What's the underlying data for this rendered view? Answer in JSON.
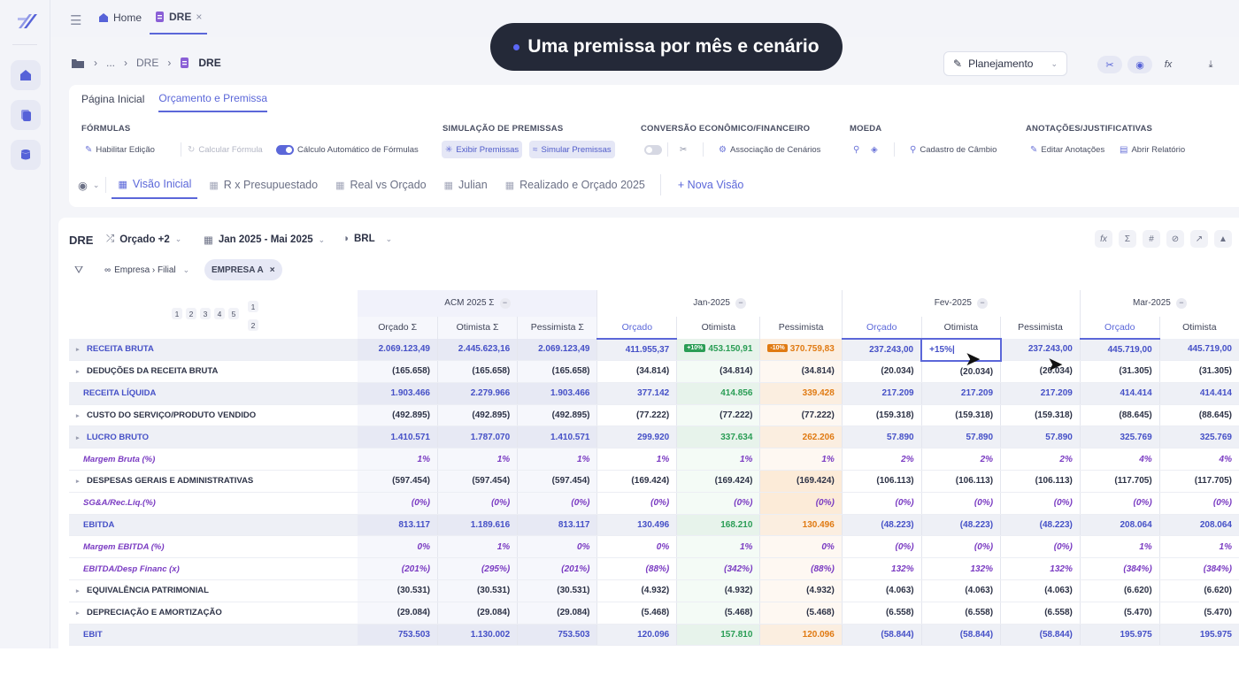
{
  "topbar": {
    "tabs": [
      {
        "label": "Home",
        "icon": "home-icon",
        "active": false
      },
      {
        "label": "DRE",
        "icon": "document-icon",
        "active": true,
        "close": "×"
      }
    ]
  },
  "toast": {
    "text": "Uma premissa por mês e cenário"
  },
  "breadcrumb": {
    "ellipsis": "...",
    "parent": "DRE",
    "current": "DRE"
  },
  "mode_select": {
    "label": "Planejamento"
  },
  "ribbon": {
    "tabs": [
      {
        "label": "Página Inicial",
        "active": false
      },
      {
        "label": "Orçamento e Premissa",
        "active": true
      }
    ],
    "groups": {
      "formulas": "FÓRMULAS",
      "simulacao": "SIMULAÇÃO DE PREMISSAS",
      "conversao": "CONVERSÃO ECONÔMICO/FINANCEIRO",
      "moeda": "MOEDA",
      "anotacoes": "ANOTAÇÕES/JUSTIFICATIVAS"
    },
    "buttons": {
      "habilitar": "Habilitar Edição",
      "calcular": "Calcular Fórmula",
      "calculo_auto": "Cálculo Automático de Fórmulas",
      "exibir": "Exibir Premissas",
      "simular": "Simular Premissas",
      "associacao": "Associação de Cenários",
      "cambio": "Cadastro de Câmbio",
      "editar_anot": "Editar Anotações",
      "abrir_rel": "Abrir Relatório"
    },
    "views": [
      {
        "label": "Visão Inicial",
        "active": true
      },
      {
        "label": "R x Presupuestado",
        "active": false
      },
      {
        "label": "Real vs Orçado",
        "active": false
      },
      {
        "label": "Julian",
        "active": false
      },
      {
        "label": "Realizado e Orçado 2025",
        "active": false
      }
    ],
    "new_view": "+ Nova Visão"
  },
  "report": {
    "title": "DRE",
    "scenario": "Orçado +2",
    "period": "Jan 2025 - Mai 2025",
    "currency": "BRL",
    "filter_chip": "Empresa › Filial",
    "selected_chip": "EMPRESA A",
    "selected_chip_close": "×",
    "levels": [
      "1",
      "2",
      "3",
      "4",
      "5"
    ],
    "side_levels": [
      "1",
      "2"
    ]
  },
  "columns": {
    "groups": [
      {
        "label": "ACM 2025 Σ",
        "toggle": "−"
      },
      {
        "label": "Jan-2025",
        "toggle": "−"
      },
      {
        "label": "Fev-2025",
        "toggle": "−"
      },
      {
        "label": "Mar-2025",
        "toggle": "−"
      }
    ],
    "sub": [
      "Orçado Σ",
      "Otimista Σ",
      "Pessimista Σ",
      "Orçado",
      "Otimista",
      "Pessimista",
      "Orçado",
      "Otimista",
      "Pessimista",
      "Orçado",
      "Otimista"
    ]
  },
  "rows": [
    {
      "label": "RECEITA BRUTA",
      "tri": "▸",
      "type": "hl",
      "values": [
        "2.069.123,49",
        "2.445.623,16",
        "2.069.123,49",
        "411.955,37",
        "453.150,91",
        "370.759,83",
        "237.243,00",
        "+15%|",
        "237.243,00",
        "445.719,00",
        "445.719,00"
      ],
      "badges": {
        "4": "+10%",
        "5": "-10%"
      }
    },
    {
      "label": "DEDUÇÕES DA RECEITA BRUTA",
      "tri": "▸",
      "type": "normal",
      "values": [
        "(165.658)",
        "(165.658)",
        "(165.658)",
        "(34.814)",
        "(34.814)",
        "(34.814)",
        "(20.034)",
        "(20.034)",
        "(20.034)",
        "(31.305)",
        "(31.305)"
      ]
    },
    {
      "label": "RECEITA LÍQUIDA",
      "tri": "",
      "type": "hl",
      "values": [
        "1.903.466",
        "2.279.966",
        "1.903.466",
        "377.142",
        "414.856",
        "339.428",
        "217.209",
        "217.209",
        "217.209",
        "414.414",
        "414.414"
      ]
    },
    {
      "label": "CUSTO DO SERVIÇO/PRODUTO VENDIDO",
      "tri": "▸",
      "type": "normal",
      "values": [
        "(492.895)",
        "(492.895)",
        "(492.895)",
        "(77.222)",
        "(77.222)",
        "(77.222)",
        "(159.318)",
        "(159.318)",
        "(159.318)",
        "(88.645)",
        "(88.645)"
      ]
    },
    {
      "label": "LUCRO BRUTO",
      "tri": "▸",
      "type": "hl",
      "values": [
        "1.410.571",
        "1.787.070",
        "1.410.571",
        "299.920",
        "337.634",
        "262.206",
        "57.890",
        "57.890",
        "57.890",
        "325.769",
        "325.769"
      ]
    },
    {
      "label": "Margem Bruta (%)",
      "tri": "",
      "type": "ital",
      "values": [
        "1%",
        "1%",
        "1%",
        "1%",
        "1%",
        "1%",
        "2%",
        "2%",
        "2%",
        "4%",
        "4%"
      ]
    },
    {
      "label": "DESPESAS GERAIS E ADMINISTRATIVAS",
      "tri": "▸",
      "type": "normal",
      "values": [
        "(597.454)",
        "(597.454)",
        "(597.454)",
        "(169.424)",
        "(169.424)",
        "(169.424)",
        "(106.113)",
        "(106.113)",
        "(106.113)",
        "(117.705)",
        "(117.705)"
      ]
    },
    {
      "label": "SG&A/Rec.Liq.(%)",
      "tri": "",
      "type": "ital",
      "values": [
        "(0%)",
        "(0%)",
        "(0%)",
        "(0%)",
        "(0%)",
        "(0%)",
        "(0%)",
        "(0%)",
        "(0%)",
        "(0%)",
        "(0%)"
      ]
    },
    {
      "label": "EBITDA",
      "tri": "",
      "type": "hl",
      "values": [
        "813.117",
        "1.189.616",
        "813.117",
        "130.496",
        "168.210",
        "130.496",
        "(48.223)",
        "(48.223)",
        "(48.223)",
        "208.064",
        "208.064"
      ]
    },
    {
      "label": "Margem EBITDA (%)",
      "tri": "",
      "type": "ital",
      "values": [
        "0%",
        "1%",
        "0%",
        "0%",
        "1%",
        "0%",
        "(0%)",
        "(0%)",
        "(0%)",
        "1%",
        "1%"
      ]
    },
    {
      "label": "EBITDA/Desp Financ (x)",
      "tri": "",
      "type": "ital",
      "values": [
        "(201%)",
        "(295%)",
        "(201%)",
        "(88%)",
        "(342%)",
        "(88%)",
        "132%",
        "132%",
        "132%",
        "(384%)",
        "(384%)"
      ]
    },
    {
      "label": "EQUIVALÊNCIA PATRIMONIAL",
      "tri": "▸",
      "type": "normal",
      "values": [
        "(30.531)",
        "(30.531)",
        "(30.531)",
        "(4.932)",
        "(4.932)",
        "(4.932)",
        "(4.063)",
        "(4.063)",
        "(4.063)",
        "(6.620)",
        "(6.620)"
      ]
    },
    {
      "label": "DEPRECIAÇÃO E AMORTIZAÇÃO",
      "tri": "▸",
      "type": "normal",
      "values": [
        "(29.084)",
        "(29.084)",
        "(29.084)",
        "(5.468)",
        "(5.468)",
        "(5.468)",
        "(6.558)",
        "(6.558)",
        "(6.558)",
        "(5.470)",
        "(5.470)"
      ]
    },
    {
      "label": "EBIT",
      "tri": "",
      "type": "hl",
      "values": [
        "753.503",
        "1.130.002",
        "753.503",
        "120.096",
        "157.810",
        "120.096",
        "(58.844)",
        "(58.844)",
        "(58.844)",
        "195.975",
        "195.975"
      ]
    }
  ],
  "colors": {
    "accent": "#5b67d9",
    "positive": "#2a9d55",
    "negative": "#e07a12",
    "toast_bg": "#242938"
  }
}
